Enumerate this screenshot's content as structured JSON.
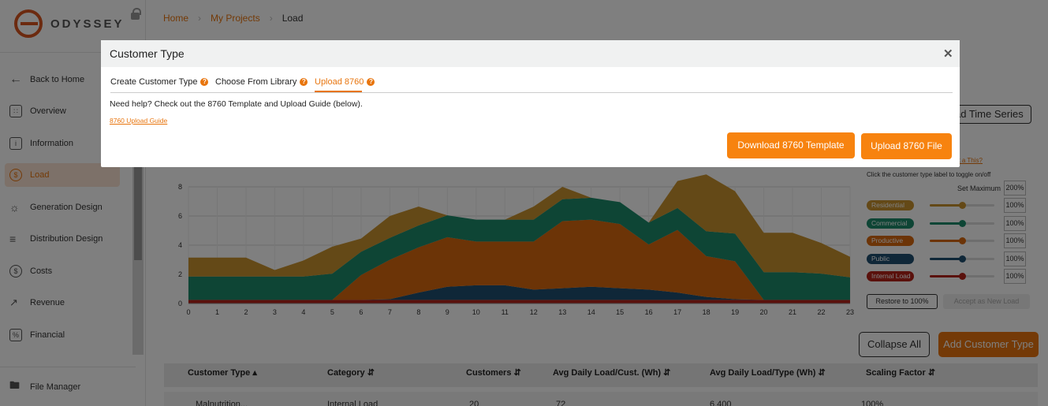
{
  "app": {
    "logo_text": "ODYSSEY"
  },
  "breadcrumb": {
    "home": "Home",
    "projects": "My Projects",
    "current": "Load"
  },
  "sidebar": {
    "items": [
      {
        "label": "Back to Home",
        "icon": "arrow-left-icon"
      },
      {
        "label": "Overview",
        "icon": "grid-icon"
      },
      {
        "label": "Information",
        "icon": "info-icon"
      },
      {
        "label": "Load",
        "icon": "shield-icon",
        "active": true
      },
      {
        "label": "Generation Design",
        "icon": "sunrise-icon"
      },
      {
        "label": "Distribution Design",
        "icon": "layers-icon"
      },
      {
        "label": "Costs",
        "icon": "dollar-icon"
      },
      {
        "label": "Revenue",
        "icon": "chart-line-icon"
      },
      {
        "label": "Financial",
        "icon": "percent-icon"
      }
    ],
    "file_manager": "File Manager"
  },
  "main": {
    "time_series_button": "ad Time Series",
    "help_link_partial": "et a This?",
    "toggle_hint": "Click the customer type label to toggle on/off",
    "set_max_label": "Set Maximum",
    "set_max_value": "200%",
    "restore_button": "Restore to 100%",
    "accept_button": "Accept as New Load",
    "collapse_button": "Collapse All",
    "add_button": "Add Customer Type"
  },
  "legend": [
    {
      "name": "Residential",
      "color": "#c9922e",
      "pct": "100%",
      "level": 0.5
    },
    {
      "name": "Commercial",
      "color": "#1c8a6a",
      "pct": "100%",
      "level": 0.5
    },
    {
      "name": "Productive",
      "color": "#d9680f",
      "pct": "100%",
      "level": 0.5
    },
    {
      "name": "Public",
      "color": "#1f4f70",
      "pct": "100%",
      "level": 0.5
    },
    {
      "name": "Internal Load",
      "color": "#b52218",
      "pct": "100%",
      "level": 0.5
    }
  ],
  "table": {
    "headers": [
      "Customer Type",
      "Category",
      "Customers",
      "Avg Daily Load/Cust. (Wh)",
      "Avg Daily Load/Type (Wh)",
      "Scaling Factor"
    ],
    "row_partial": [
      "Malnutrition...",
      "Internal Load",
      "20",
      "72",
      "6,400",
      "100%"
    ]
  },
  "modal": {
    "title": "Customer Type",
    "tabs": [
      {
        "label": "Create Customer Type"
      },
      {
        "label": "Choose From Library"
      },
      {
        "label": "Upload 8760",
        "active": true
      }
    ],
    "help_text": "Need help? Check out the 8760 Template and Upload Guide (below).",
    "guide_link": "8760 Upload Guide",
    "download_button": "Download 8760 Template",
    "upload_button": "Upload 8760 File",
    "close_icon": "close-icon"
  },
  "chart_data": {
    "type": "area",
    "stacked": true,
    "x": [
      0,
      1,
      2,
      3,
      4,
      5,
      6,
      7,
      8,
      9,
      10,
      11,
      12,
      13,
      14,
      15,
      16,
      17,
      18,
      19,
      20,
      21,
      22,
      23
    ],
    "xlim": [
      0,
      23
    ],
    "ylim": [
      0,
      8
    ],
    "yticks": [
      0,
      2,
      4,
      6,
      8
    ],
    "grid": true,
    "series": [
      {
        "name": "Internal Load",
        "color": "#b52218",
        "values": [
          0.25,
          0.25,
          0.25,
          0.25,
          0.25,
          0.25,
          0.25,
          0.25,
          0.25,
          0.25,
          0.25,
          0.25,
          0.25,
          0.25,
          0.25,
          0.25,
          0.25,
          0.25,
          0.25,
          0.25,
          0.25,
          0.25,
          0.25,
          0.25
        ]
      },
      {
        "name": "Public",
        "color": "#1f4f70",
        "values": [
          0,
          0,
          0,
          0,
          0,
          0,
          0,
          0.05,
          0.5,
          0.9,
          1.0,
          1.0,
          0.7,
          0.8,
          0.9,
          0.8,
          0.7,
          0.5,
          0.2,
          0.05,
          0,
          0,
          0,
          0
        ]
      },
      {
        "name": "Productive",
        "color": "#d9680f",
        "values": [
          0,
          0,
          0,
          0,
          0,
          0,
          1.7,
          2.7,
          3.1,
          3.4,
          3.0,
          3.0,
          3.3,
          4.6,
          4.6,
          4.4,
          3.1,
          4.3,
          2.8,
          2.6,
          0,
          0,
          0,
          0
        ]
      },
      {
        "name": "Commercial",
        "color": "#1c8a6a",
        "values": [
          1.6,
          1.6,
          1.6,
          1.6,
          1.6,
          1.8,
          1.6,
          1.5,
          1.5,
          1.5,
          1.5,
          1.5,
          1.5,
          1.5,
          1.5,
          1.5,
          1.5,
          1.5,
          1.7,
          1.9,
          1.9,
          1.9,
          1.8,
          1.55
        ]
      },
      {
        "name": "Residential",
        "color": "#c9922e",
        "values": [
          1.3,
          1.3,
          1.3,
          0.45,
          1.1,
          1.85,
          0.9,
          1.5,
          1.3,
          0,
          0,
          0,
          0.9,
          0.85,
          0,
          0,
          0,
          1.85,
          3.9,
          2.9,
          2.7,
          2.7,
          2.1,
          1.4
        ]
      }
    ]
  }
}
